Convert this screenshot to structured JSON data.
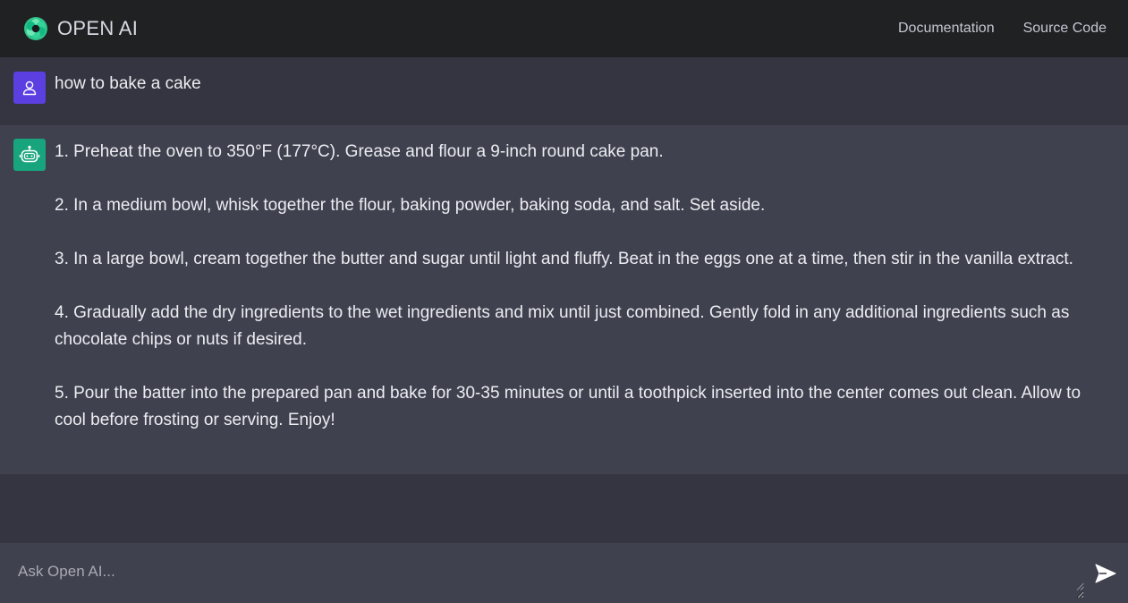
{
  "header": {
    "brand": "OPEN AI",
    "nav": [
      "Documentation",
      "Source Code"
    ]
  },
  "conversation": {
    "user_message": "how to bake a cake",
    "bot_paragraphs": [
      "1. Preheat the oven to 350°F (177°C). Grease and flour a 9-inch round cake pan.",
      "2. In a medium bowl, whisk together the flour, baking powder, baking soda, and salt. Set aside.",
      "3. In a large bowl, cream together the butter and sugar until light and fluffy. Beat in the eggs one at a time, then stir in the vanilla extract.",
      "4. Gradually add the dry ingredients to the wet ingredients and mix until just combined. Gently fold in any additional ingredients such as chocolate chips or nuts if desired.",
      "5. Pour the batter into the prepared pan and bake for 30-35 minutes or until a toothpick inserted into the center comes out clean. Allow to cool before frosting or serving. Enjoy!"
    ]
  },
  "input": {
    "placeholder": "Ask Open AI...",
    "value": ""
  },
  "icons": {
    "logo": "openai-logo-icon",
    "user_avatar": "user-icon",
    "bot_avatar": "robot-icon",
    "send": "send-icon"
  },
  "colors": {
    "header_bg": "#202123",
    "user_bg": "#353541",
    "bot_bg": "#40414f",
    "user_avatar": "#5b3fe0",
    "bot_avatar": "#18a47c",
    "logo_green": "#3fd49a"
  }
}
